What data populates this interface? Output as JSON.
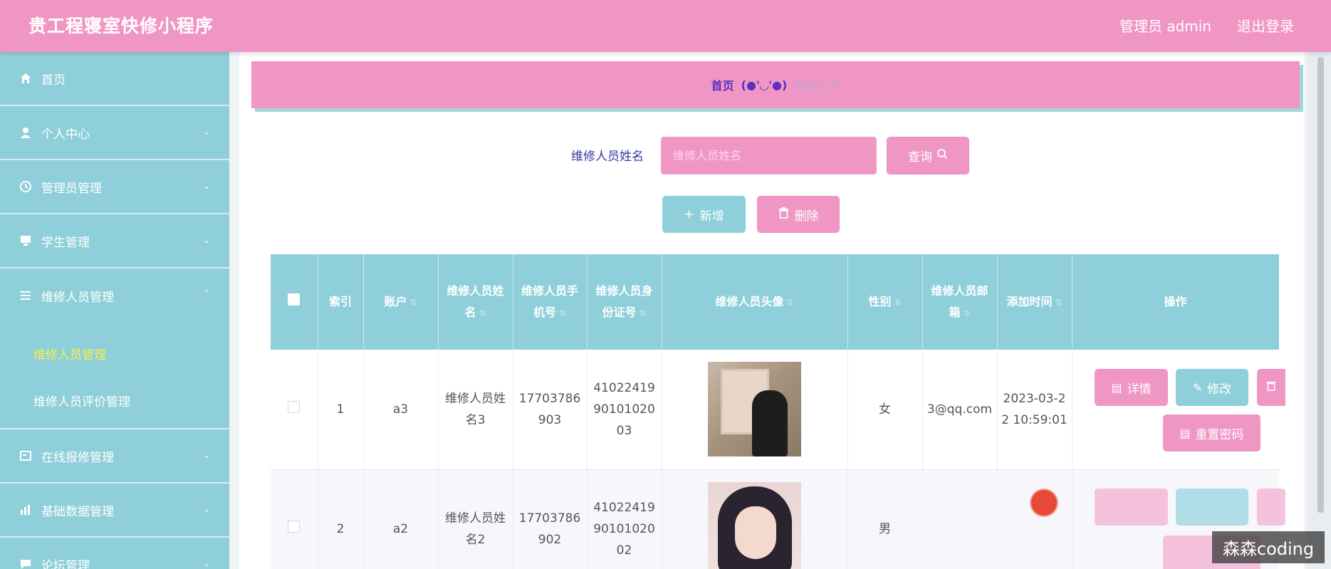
{
  "app": {
    "title": "贵工程寝室快修小程序"
  },
  "header": {
    "user": "管理员 admin",
    "logout": "退出登录"
  },
  "sidebar": {
    "items": [
      {
        "label": "首页",
        "icon": "home-icon"
      },
      {
        "label": "个人中心",
        "icon": "user-icon"
      },
      {
        "label": "管理员管理",
        "icon": "clock-icon"
      },
      {
        "label": "学生管理",
        "icon": "monitor-icon"
      },
      {
        "label": "维修人员管理",
        "icon": "list-icon"
      },
      {
        "label": "在线报修管理",
        "icon": "card-icon"
      },
      {
        "label": "基础数据管理",
        "icon": "chart-icon"
      },
      {
        "label": "论坛管理",
        "icon": "chat-icon"
      }
    ],
    "subitems": [
      {
        "label": "维修人员管理",
        "active": true
      },
      {
        "label": "维修人员评价管理",
        "active": false
      }
    ]
  },
  "breadcrumb": {
    "home": "首页",
    "face": "(●'◡'●)",
    "current": "维修人员"
  },
  "search": {
    "label": "维修人员姓名",
    "placeholder": "维修人员姓名",
    "query_button": "查询"
  },
  "actions": {
    "add": "新增",
    "delete": "删除"
  },
  "table": {
    "headers": [
      "",
      "索引",
      "账户",
      "维修人员姓名",
      "维修人员手机号",
      "维修人员身份证号",
      "维修人员头像",
      "性别",
      "维修人员邮箱",
      "添加时间",
      "操作"
    ],
    "rows": [
      {
        "index": "1",
        "account": "a3",
        "name": "维修人员姓名3",
        "phone": "17703786903",
        "id_card": "410224199010102003",
        "gender": "女",
        "email": "3@qq.com",
        "added": "2023-03-22 10:59:01"
      },
      {
        "index": "2",
        "account": "a2",
        "name": "维修人员姓名2",
        "phone": "17703786902",
        "id_card": "410224199010102002",
        "gender": "男",
        "email": "",
        "added": ""
      }
    ],
    "row_actions": {
      "detail": "详情",
      "edit": "修改",
      "reset": "重置密码"
    }
  },
  "watermark": "森森coding",
  "colors": {
    "pink": "#f096c4",
    "teal": "#8ecfd9",
    "purple": "#5a2fc2",
    "active_yellow": "#f5f04a"
  }
}
